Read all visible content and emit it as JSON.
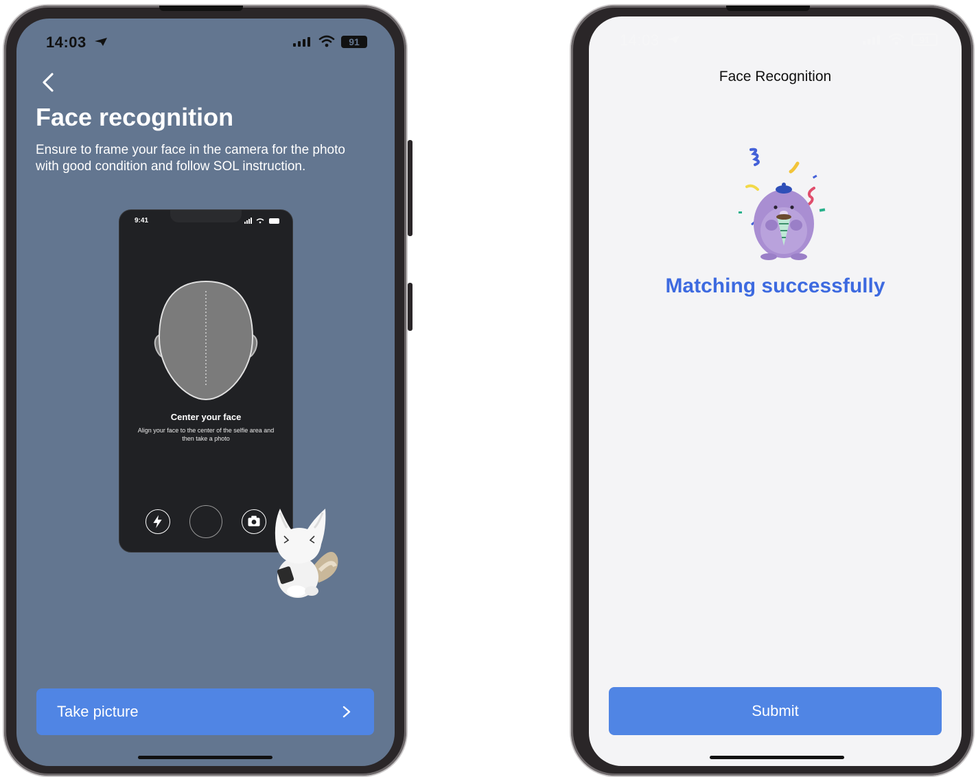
{
  "left_screen": {
    "status_bar": {
      "time": "14:03",
      "battery": "91"
    },
    "title": "Face recognition",
    "description": "Ensure to frame your face in the camera for the photo with good condition and follow SOL instruction.",
    "illustration": {
      "time": "9:41",
      "heading": "Center your face",
      "subtext": "Align your face to the center of the selfie area and then take a photo"
    },
    "primary_button": "Take picture"
  },
  "right_screen": {
    "status_bar": {
      "time": "14:03",
      "battery": "91"
    },
    "title": "Face Recognition",
    "message": "Matching successfully",
    "primary_button": "Submit"
  },
  "colors": {
    "left_background": "#637690",
    "button_blue": "#5085e4",
    "success_text": "#3d6ae0",
    "right_background": "#f4f4f6"
  },
  "icons": [
    "location-arrow-icon",
    "signal-icon",
    "wifi-icon",
    "battery-icon",
    "back-chevron-icon",
    "chevron-right-icon",
    "flash-icon",
    "camera-switch-icon"
  ]
}
